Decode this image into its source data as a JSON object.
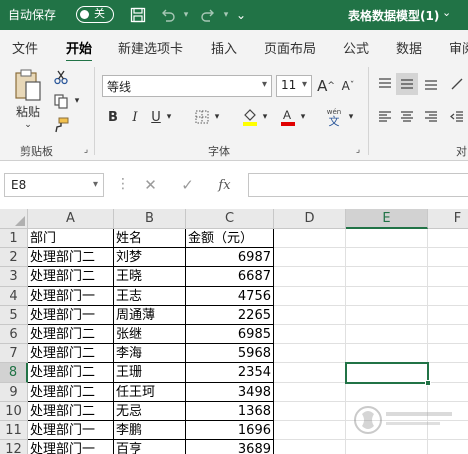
{
  "titlebar": {
    "autosave_label": "自动保存",
    "toggle_label": "关",
    "doc_title": "表格数据模型(1)",
    "dropdown_glyph": "⌄"
  },
  "tabs": [
    "文件",
    "开始",
    "新建选项卡",
    "插入",
    "页面布局",
    "公式",
    "数据",
    "审阅"
  ],
  "active_tab": "开始",
  "ribbon": {
    "clipboard": {
      "paste_label": "粘贴",
      "group_label": "剪贴板"
    },
    "font": {
      "font_name": "等线",
      "font_size": "11",
      "group_label": "字体",
      "bold": "B",
      "italic": "I",
      "underline": "U",
      "grow": "A",
      "shrink": "A",
      "phonetic_top": "wén",
      "phonetic_bottom": "文"
    },
    "align_group_partial": "对"
  },
  "formula_bar": {
    "name_box": "E8",
    "cancel": "✕",
    "enter": "✓",
    "fx": "fx",
    "formula": ""
  },
  "grid": {
    "columns": [
      "A",
      "B",
      "C",
      "D",
      "E",
      "F"
    ],
    "selected_column": "E",
    "selected_row": 8,
    "rows": [
      {
        "n": "1",
        "a": "部门",
        "b": "姓名",
        "c": "金额（元）"
      },
      {
        "n": "2",
        "a": "处理部门二",
        "b": "刘梦",
        "c": "6987"
      },
      {
        "n": "3",
        "a": "处理部门二",
        "b": "王晓",
        "c": "6687"
      },
      {
        "n": "4",
        "a": "处理部门一",
        "b": "王志",
        "c": "4756"
      },
      {
        "n": "5",
        "a": "处理部门一",
        "b": "周通薄",
        "c": "2265"
      },
      {
        "n": "6",
        "a": "处理部门二",
        "b": "张继",
        "c": "6985"
      },
      {
        "n": "7",
        "a": "处理部门二",
        "b": "李海",
        "c": "5968"
      },
      {
        "n": "8",
        "a": "处理部门二",
        "b": "王珊",
        "c": "2354"
      },
      {
        "n": "9",
        "a": "处理部门二",
        "b": "任王珂",
        "c": "3498"
      },
      {
        "n": "10",
        "a": "处理部门二",
        "b": "无忌",
        "c": "1368"
      },
      {
        "n": "11",
        "a": "处理部门一",
        "b": "李鹏",
        "c": "1696"
      },
      {
        "n": "12",
        "a": "处理部门一",
        "b": "百亨",
        "c": "3689"
      }
    ]
  },
  "colors": {
    "accent": "#217346",
    "font_color": "#e00000",
    "highlight": "#ffff00"
  }
}
